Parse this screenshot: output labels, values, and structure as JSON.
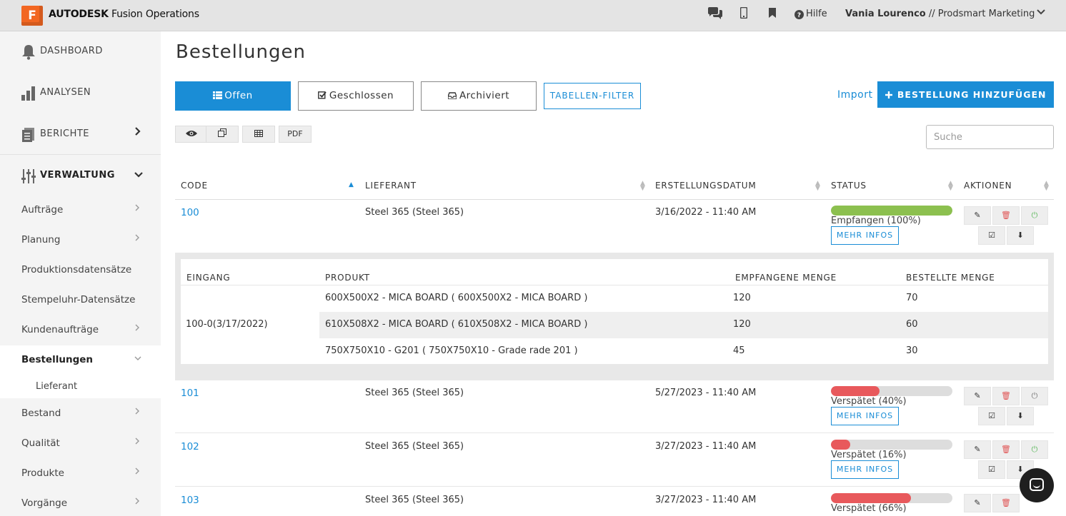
{
  "app": {
    "logo_letter": "F",
    "brand_bold": "AUTODESK",
    "brand_rest": " Fusion Operations",
    "help_label": "Hilfe",
    "user_name": "Vania Lourenco",
    "user_org": " // Prodsmart Marketing"
  },
  "sidebar": {
    "dashboard": "DASHBOARD",
    "analysen": "ANALYSEN",
    "berichte": "BERICHTE",
    "verwaltung": "VERWALTUNG",
    "auftraege": "Aufträge",
    "planung": "Planung",
    "produktionsdatensaetze": "Produktionsdatensätze",
    "stempeluhr": "Stempeluhr-Datensätze",
    "kundenauftraege": "Kundenaufträge",
    "bestellungen": "Bestellungen",
    "lieferant": "Lieferant",
    "bestand": "Bestand",
    "qualitaet": "Qualität",
    "produkte": "Produkte",
    "vorgaenge": "Vorgänge"
  },
  "page": {
    "title": "Bestellungen",
    "tab_offen": "Offen",
    "tab_geschlossen": "Geschlossen",
    "tab_archiviert": "Archiviert",
    "filter": "TABELLEN-FILTER",
    "import": "Import",
    "add": "BESTELLUNG HINZUFÜGEN",
    "pdf": "PDF",
    "search_placeholder": "Suche"
  },
  "table": {
    "headers": {
      "code": "CODE",
      "lieferant": "LIEFERANT",
      "datum": "ERSTELLUNGSDATUM",
      "status": "STATUS",
      "aktionen": "AKTIONEN"
    },
    "mehr_infos": "MEHR INFOS",
    "rows": [
      {
        "code": "100",
        "supplier": "Steel 365 (Steel 365)",
        "date": "3/16/2022 - 11:40 AM",
        "status": "Empfangen (100%)",
        "progress": 1.0,
        "color": "#8cc04f"
      },
      {
        "code": "101",
        "supplier": "Steel 365 (Steel 365)",
        "date": "5/27/2023 - 11:40 AM",
        "status": "Verspätet (40%)",
        "progress": 0.4,
        "color": "#e8595c"
      },
      {
        "code": "102",
        "supplier": "Steel 365 (Steel 365)",
        "date": "3/27/2023 - 11:40 AM",
        "status": "Verspätet (16%)",
        "progress": 0.16,
        "color": "#e8595c"
      },
      {
        "code": "103",
        "supplier": "Steel 365 (Steel 365)",
        "date": "3/27/2023 - 11:40 AM",
        "status": "Verspätet (66%)",
        "progress": 0.66,
        "color": "#e8595c"
      }
    ]
  },
  "detail": {
    "headers": {
      "eingang": "EINGANG",
      "produkt": "PRODUKT",
      "empfangen": "EMPFANGENE MENGE",
      "bestellt": "BESTELLTE MENGE"
    },
    "eingang": "100-0(3/17/2022)",
    "items": [
      {
        "product": "600X500X2 - MICA BOARD ( 600X500X2 - MICA BOARD )",
        "received": "120",
        "ordered": "70"
      },
      {
        "product": "610X508X2 - MICA BOARD ( 610X508X2 - MICA BOARD )",
        "received": "120",
        "ordered": "60"
      },
      {
        "product": "750X750X10 - G201 ( 750X750X10 - Grade rade 201 )",
        "received": "45",
        "ordered": "30"
      }
    ]
  }
}
